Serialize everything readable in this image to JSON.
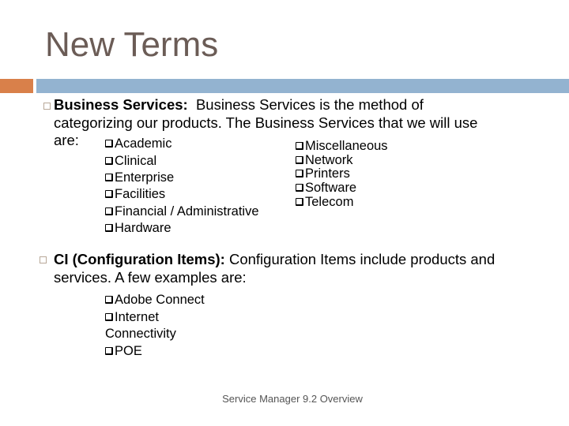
{
  "slide": {
    "title": "New Terms",
    "accent_colors": {
      "orange": "#d9804a",
      "blue": "#93b3d0",
      "title": "#6b5c56"
    },
    "bullets": [
      {
        "term": "Business Services:",
        "line1": "  Business Services is the method of",
        "line2": "categorizing our products.  The Business Services that we will use",
        "line3": "are:",
        "items_left": [
          "Academic",
          "Clinical",
          "Enterprise",
          "Facilities",
          "Financial / Administrative",
          "Hardware"
        ],
        "items_right": [
          "Miscellaneous",
          "Network",
          "Printers",
          "Software",
          "Telecom"
        ]
      },
      {
        "term": "CI (Configuration Items):",
        "line1": " Configuration Items include products and",
        "line2": "services.  A few examples are:",
        "items": [
          "Adobe Connect",
          "Internet",
          "Connectivity",
          "POE"
        ]
      }
    ],
    "footer": "Service Manager 9.2 Overview"
  }
}
